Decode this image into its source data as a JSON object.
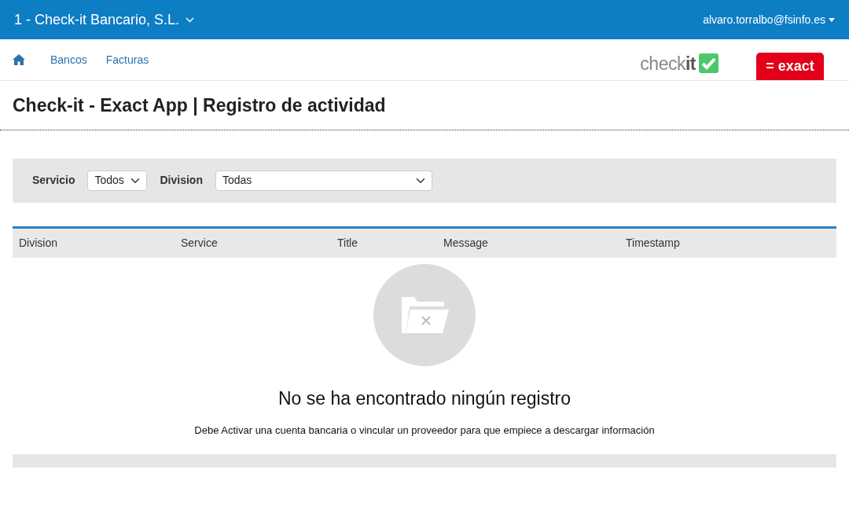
{
  "topbar": {
    "company": "1 - Check-it Bancario, S.L.",
    "user": "alvaro.torralbo@fsinfo.es"
  },
  "nav": {
    "links": [
      "Bancos",
      "Facturas"
    ]
  },
  "logos": {
    "checkit_light": "check",
    "checkit_bold": "it",
    "exact": "= exact"
  },
  "page_title": "Check-it - Exact App | Registro de actividad",
  "filters": [
    {
      "label": "Servicio",
      "value": "Todos"
    },
    {
      "label": "Division",
      "value": "Todas"
    }
  ],
  "table": {
    "columns": [
      "Division",
      "Service",
      "Title",
      "Message",
      "Timestamp"
    ]
  },
  "empty_state": {
    "title": "No se ha encontrado ningún registro",
    "message": "Debe Activar una cuenta bancaria o vincular un proveedor para que empiece a descargar información"
  }
}
